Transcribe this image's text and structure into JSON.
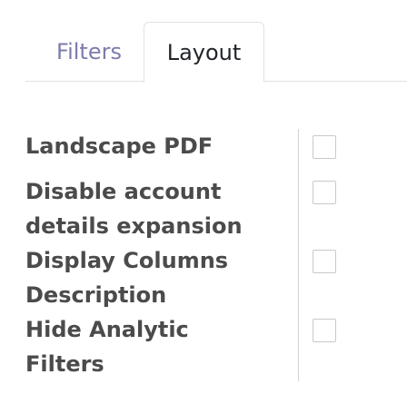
{
  "tabs": {
    "filters_label": "Filters",
    "layout_label": "Layout",
    "active": "Layout"
  },
  "options": [
    {
      "label": "Landscape PDF",
      "checked": false
    },
    {
      "label": "Disable account details expansion",
      "checked": false
    },
    {
      "label": "Display Columns Description",
      "checked": false
    },
    {
      "label": "Hide Analytic Filters",
      "checked": false
    }
  ],
  "colors": {
    "inactive_tab_text": "#7c7bad",
    "active_tab_text": "#212529",
    "label_text": "#4b4b4b",
    "border": "#dee2e6"
  }
}
